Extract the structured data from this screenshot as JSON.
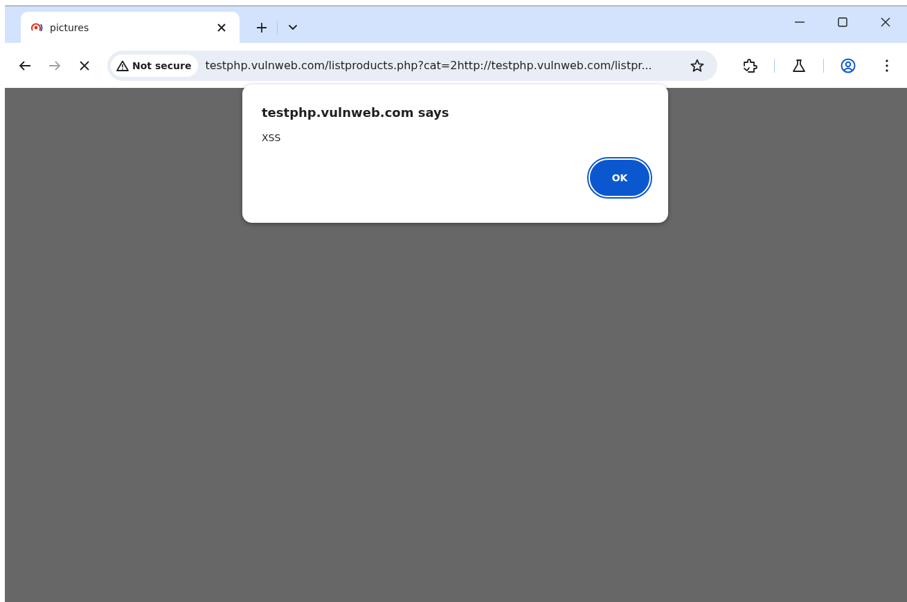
{
  "tabs": [
    {
      "title": "pictures",
      "selected": true
    }
  ],
  "toolbar": {
    "back_disabled": false,
    "forward_disabled": true,
    "loading": true
  },
  "address_bar": {
    "security_label": "Not secure",
    "url": "testphp.vulnweb.com/listproducts.php?cat=2http://testphp.vulnweb.com/listpr..."
  },
  "dialog": {
    "title": "testphp.vulnweb.com says",
    "message": "XSS",
    "button": "OK"
  }
}
